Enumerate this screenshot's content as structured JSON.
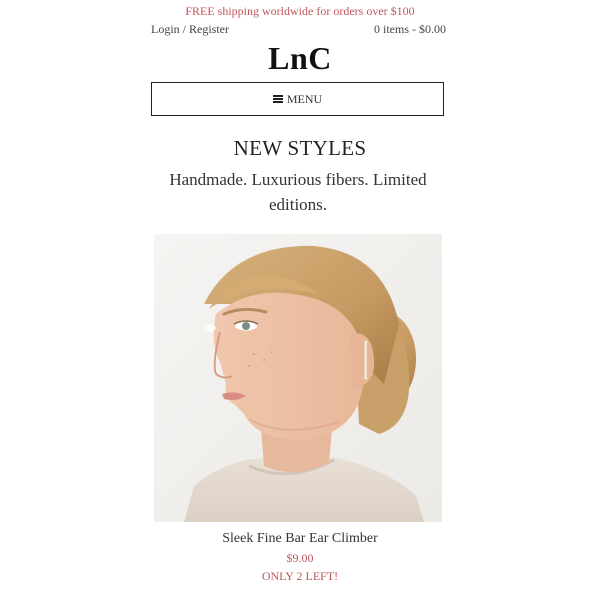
{
  "header": {
    "promo_text": "FREE shipping worldwide for orders over $100",
    "login_label": "Login / Register",
    "cart_label": "0 items - $0.00",
    "logo_text": "LnC",
    "menu_label": "MENU",
    "menu_icon": "hamburger-icon"
  },
  "section": {
    "title": "NEW STYLES",
    "subtitle": "Handmade. Luxurious fibers. Limited editions."
  },
  "product": {
    "name": "Sleek Fine Bar Ear Climber",
    "price": "$9.00",
    "stock_note": "ONLY 2 LEFT!"
  },
  "colors": {
    "accent": "#c0555a",
    "text": "#222222",
    "border": "#222222"
  }
}
